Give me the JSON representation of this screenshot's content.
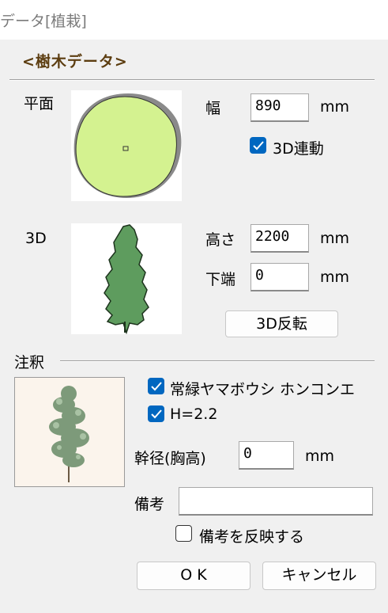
{
  "window": {
    "title": "データ[植栽]"
  },
  "section": {
    "title": "<樹木データ>"
  },
  "plan": {
    "label": "平面",
    "width_label": "幅",
    "width_value": "890",
    "width_unit": "mm",
    "link3d_label": "3D連動",
    "link3d_checked": true
  },
  "view3d": {
    "label": "3D",
    "height_label": "高さ",
    "height_value": "2200",
    "height_unit": "mm",
    "bottom_label": "下端",
    "bottom_value": "0",
    "bottom_unit": "mm",
    "flip_button": "3D反転"
  },
  "annotation": {
    "label": "注釈",
    "name_label": "常緑ヤマボウシ ホンコンエ",
    "name_checked": true,
    "height_text_label": "H=2.2",
    "height_text_checked": true,
    "trunk_label": "幹径(胸高)",
    "trunk_value": "0",
    "trunk_unit": "mm",
    "remarks_label": "備考",
    "remarks_value": "",
    "reflect_label": "備考を反映する",
    "reflect_checked": false
  },
  "buttons": {
    "ok": "O K",
    "cancel": "キャンセル"
  },
  "colors": {
    "plan_fill": "#d4f290",
    "tree_fill": "#5e9c5e",
    "accent": "#0067c0",
    "heading": "#5c3d10"
  }
}
